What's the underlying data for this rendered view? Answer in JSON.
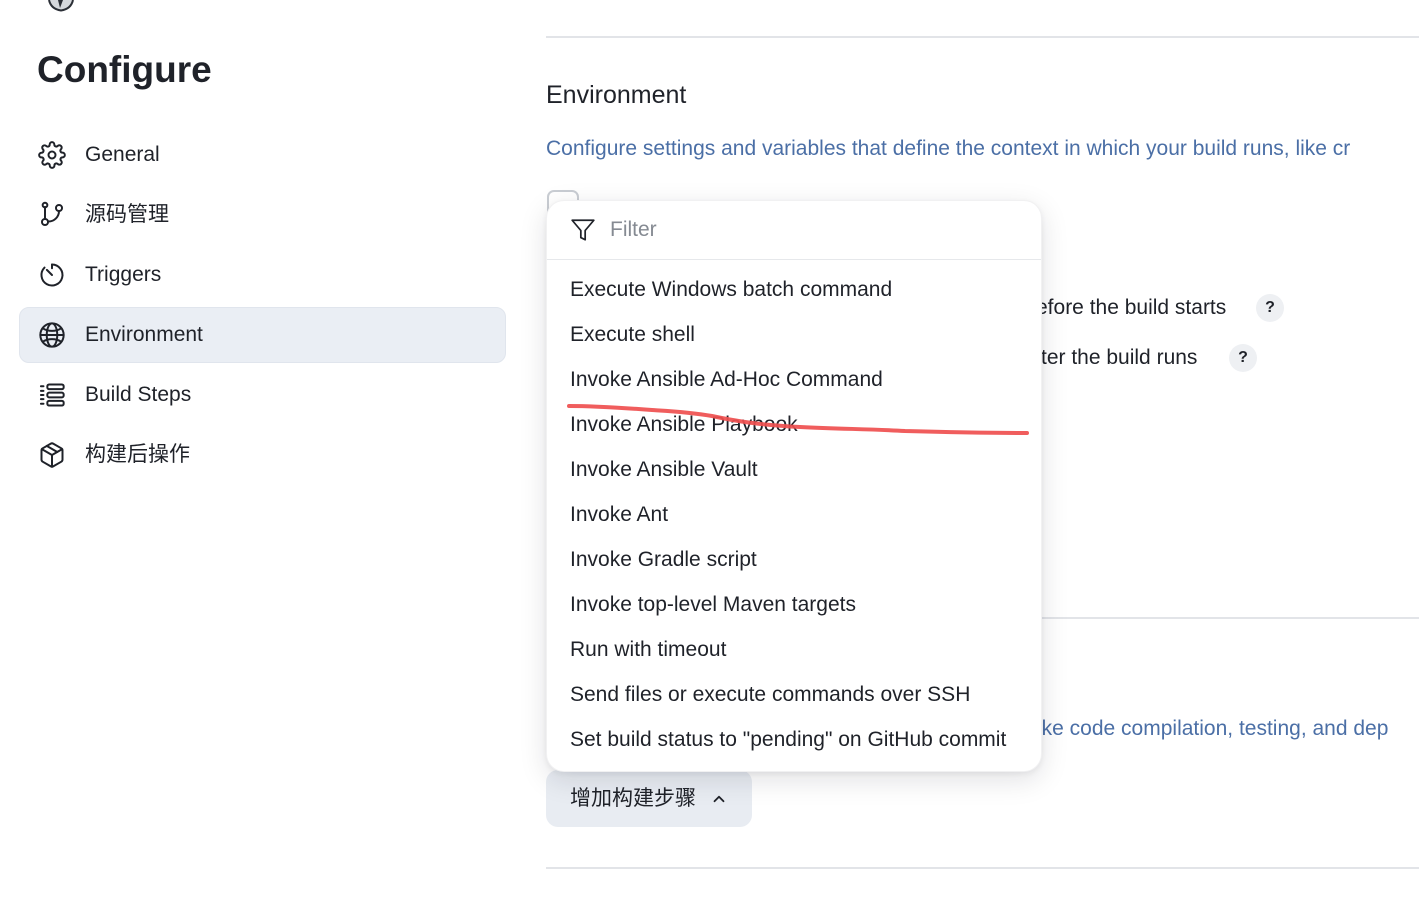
{
  "sidebar": {
    "title": "Configure",
    "items": [
      {
        "label": "General",
        "icon": "gear-icon",
        "selected": false
      },
      {
        "label": "源码管理",
        "icon": "git-branch-icon",
        "selected": false
      },
      {
        "label": "Triggers",
        "icon": "timer-icon",
        "selected": false
      },
      {
        "label": "Environment",
        "icon": "globe-icon",
        "selected": true
      },
      {
        "label": "Build Steps",
        "icon": "list-icon",
        "selected": false
      },
      {
        "label": "构建后操作",
        "icon": "package-icon",
        "selected": false
      }
    ]
  },
  "environment_section": {
    "title": "Environment",
    "description": "Configure settings and variables that define the context in which your build runs, like cr",
    "options": [
      {
        "label_fragment": "efore the build starts",
        "help": "?"
      },
      {
        "label_fragment": "ter the build runs",
        "help": "?"
      }
    ]
  },
  "build_steps_section": {
    "description_fragment": "ike code compilation, testing, and dep",
    "add_step_button": {
      "label": "增加构建步骤",
      "icon": "chevron-up-icon",
      "expanded": true
    }
  },
  "add_step_dropdown": {
    "filter_icon": "filter-icon",
    "filter_placeholder": "Filter",
    "filter_value": "",
    "items": [
      "Execute Windows batch command",
      "Execute shell",
      "Invoke Ansible Ad-Hoc Command",
      "Invoke Ansible Playbook",
      "Invoke Ansible Vault",
      "Invoke Ant",
      "Invoke Gradle script",
      "Invoke top-level Maven targets",
      "Run with timeout",
      "Send files or execute commands over SSH",
      "Set build status to \"pending\" on GitHub commit"
    ]
  },
  "colors": {
    "accent_text": "#4b6fa6",
    "selected_nav_bg": "#eaeef4",
    "button_bg": "#e8ecf2",
    "annotation_stroke": "#ef4f4f"
  }
}
